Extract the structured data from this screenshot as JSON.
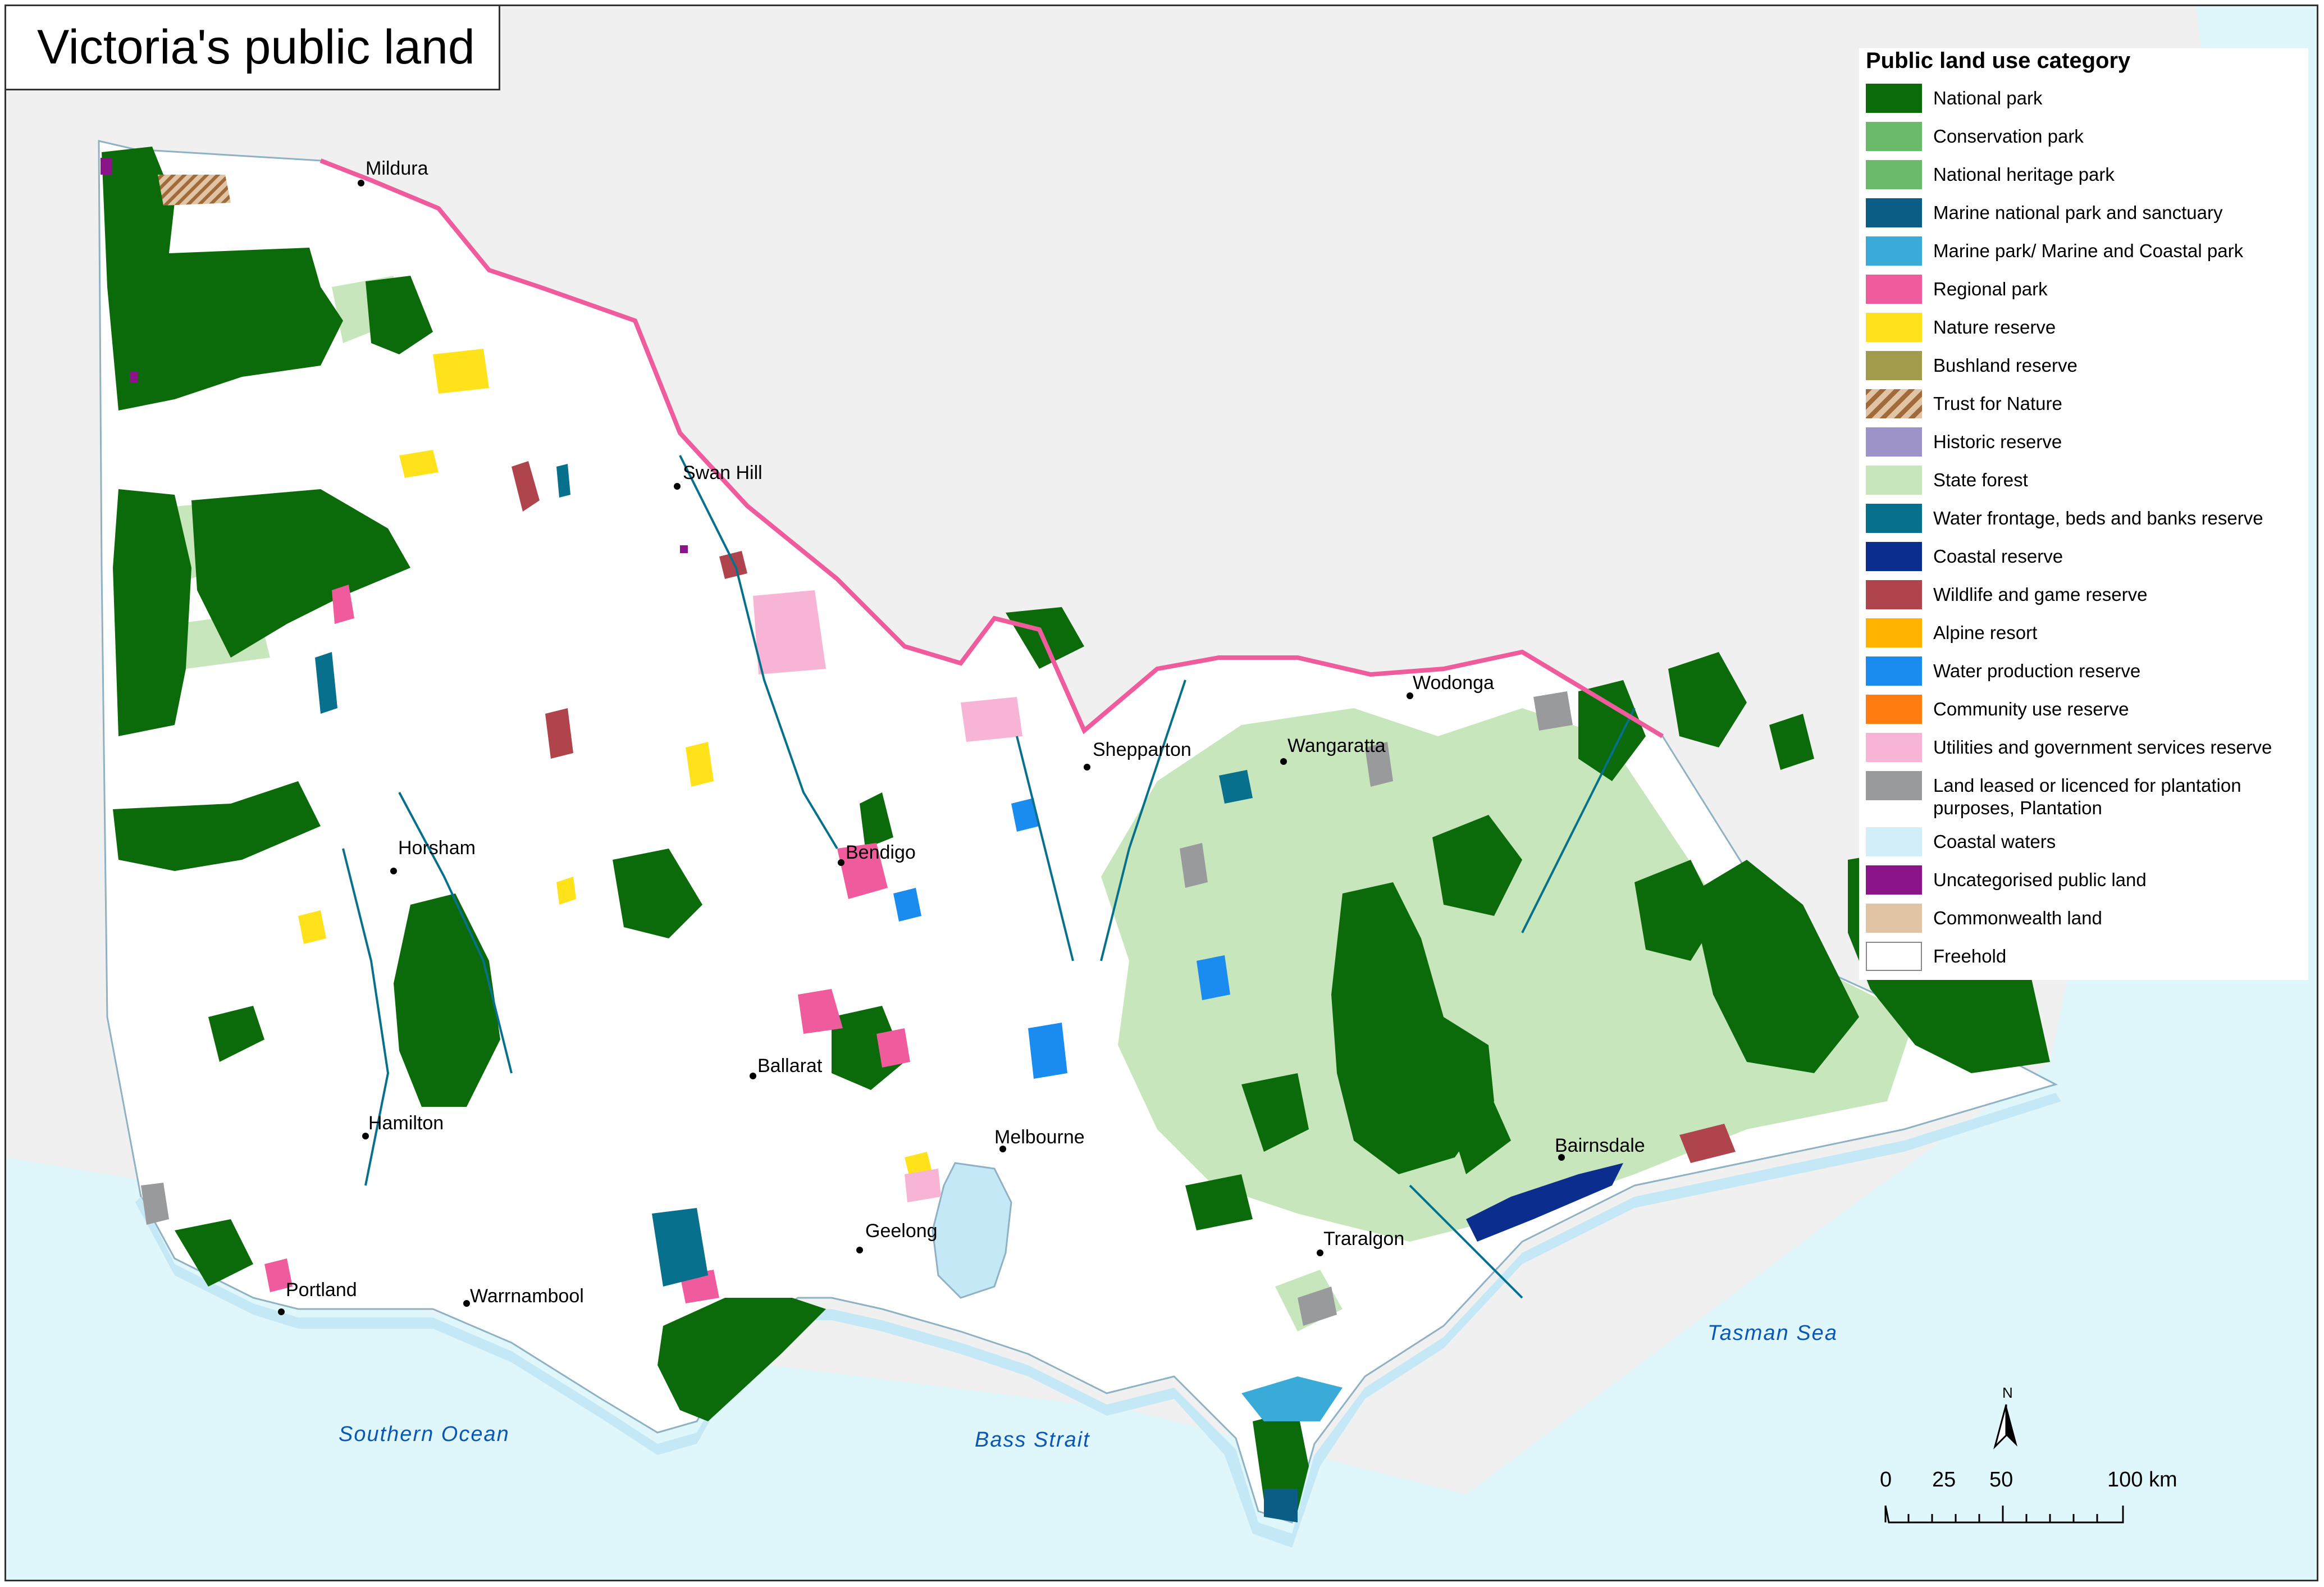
{
  "title": "Victoria's public land",
  "legend": {
    "heading": "Public land use category",
    "items": [
      {
        "label": "National park",
        "color": "#0b6b0b"
      },
      {
        "label": "Conservation park",
        "color": "#6bb96b"
      },
      {
        "label": "National heritage park",
        "color": "#6bb96b"
      },
      {
        "label": "Marine national park and sanctuary",
        "color": "#0c5d86"
      },
      {
        "label": "Marine park/ Marine and Coastal park",
        "color": "#3aaad9"
      },
      {
        "label": "Regional park",
        "color": "#ef5b9c"
      },
      {
        "label": "Nature reserve",
        "color": "#ffe219"
      },
      {
        "label": "Bushland reserve",
        "color": "#a09c4c"
      },
      {
        "label": "Trust for Nature",
        "color": "hatched"
      },
      {
        "label": "Historic reserve",
        "color": "#9d93c9"
      },
      {
        "label": "State forest",
        "color": "#c8e6bc"
      },
      {
        "label": "Water frontage, beds and banks reserve",
        "color": "#07708c"
      },
      {
        "label": "Coastal reserve",
        "color": "#0a2d8e"
      },
      {
        "label": "Wildlife and game reserve",
        "color": "#b0444c"
      },
      {
        "label": "Alpine resort",
        "color": "#ffb300"
      },
      {
        "label": "Water production reserve",
        "color": "#1a8cf0"
      },
      {
        "label": "Community use reserve",
        "color": "#ff7d10"
      },
      {
        "label": "Utilities and government services reserve",
        "color": "#f8b4d4"
      },
      {
        "label": "Land leased or licenced for plantation purposes, Plantation",
        "color": "#999a9b"
      },
      {
        "label": "Coastal waters",
        "color": "#d2eef8"
      },
      {
        "label": "Uncategorised public land",
        "color": "#8b1489"
      },
      {
        "label": "Commonwealth land",
        "color": "#e0c4a4"
      },
      {
        "label": "Freehold",
        "color": "#ffffff"
      }
    ]
  },
  "places": [
    {
      "name": "Mildura"
    },
    {
      "name": "Swan Hill"
    },
    {
      "name": "Horsham"
    },
    {
      "name": "Bendigo"
    },
    {
      "name": "Shepparton"
    },
    {
      "name": "Wangaratta"
    },
    {
      "name": "Wodonga"
    },
    {
      "name": "Ballarat"
    },
    {
      "name": "Hamilton"
    },
    {
      "name": "Melbourne"
    },
    {
      "name": "Geelong"
    },
    {
      "name": "Portland"
    },
    {
      "name": "Warrnambool"
    },
    {
      "name": "Traralgon"
    },
    {
      "name": "Bairnsdale"
    }
  ],
  "water_labels": {
    "southern_ocean": "Southern  Ocean",
    "bass_strait": "Bass  Strait",
    "tasman_sea": "Tasman  Sea"
  },
  "north_arrow": {
    "label": "N"
  },
  "scale_bar": {
    "ticks": [
      "0",
      "25",
      "50",
      "100 km"
    ]
  },
  "colors": {
    "sea": "#dff7fa",
    "nsw_land": "#f0f0f0",
    "freehold": "#ffffff",
    "border_line": "#ef5b9c"
  }
}
